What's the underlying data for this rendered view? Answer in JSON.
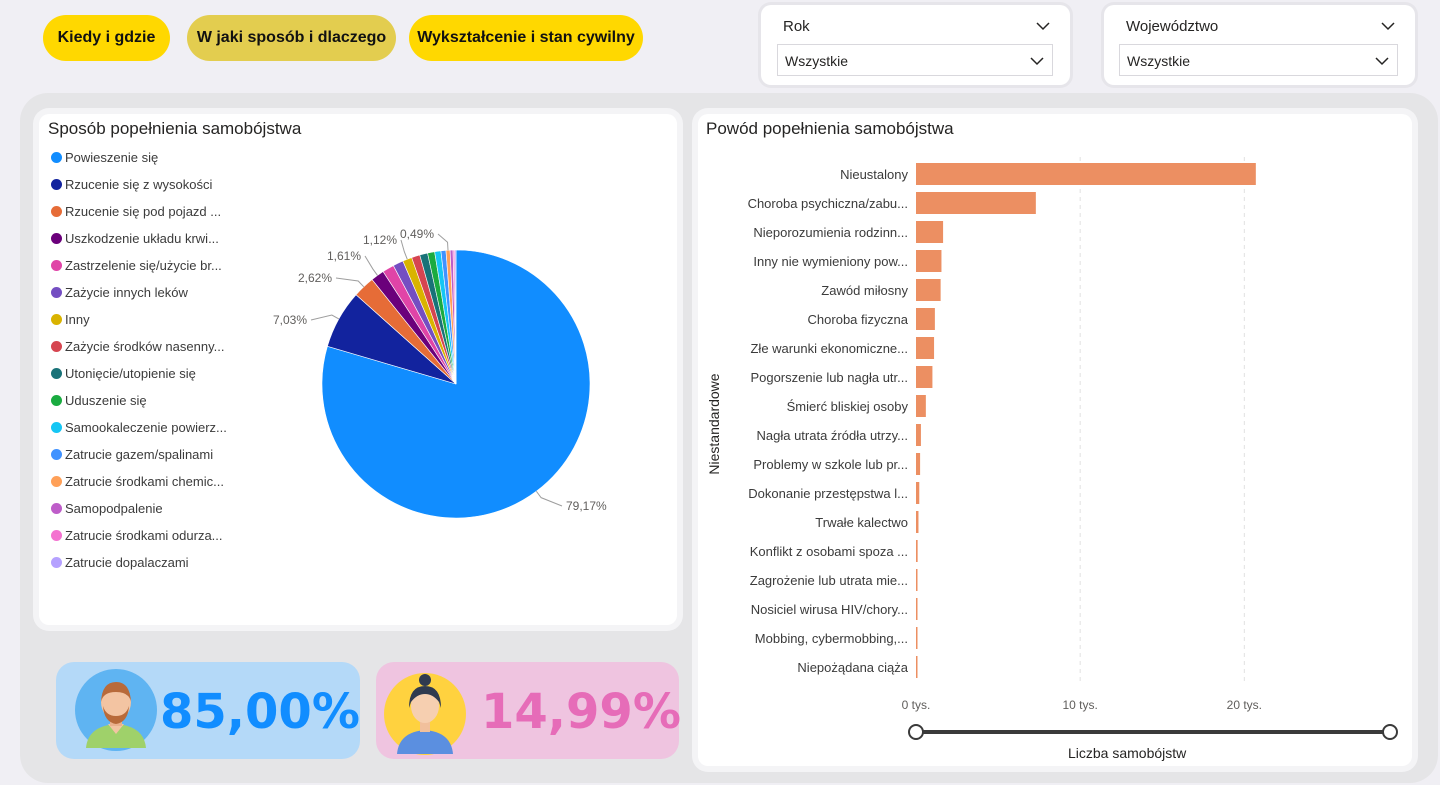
{
  "nav": {
    "btn1": "Kiedy i gdzie",
    "btn2": "W jaki sposób i dlaczego",
    "btn3": "Wykształcenie i stan cywilny"
  },
  "colors": {
    "btn_yellow": "#ffd800",
    "btn_active": "#e3cd4f",
    "bar": "#ec8f62",
    "kpi_male_bg": "#b4d9f8",
    "kpi_male_text": "#118dff",
    "kpi_female_bg": "#efc4e0",
    "kpi_female_text": "#e66cb8"
  },
  "filters": {
    "year": {
      "title": "Rok",
      "value": "Wszystkie"
    },
    "voivodeship": {
      "title": "Województwo",
      "value": "Wszystkie"
    }
  },
  "method_chart": {
    "title": "Sposób popełnienia samobójstwa",
    "legend": [
      {
        "label": "Powieszenie się",
        "color": "#118dff"
      },
      {
        "label": "Rzucenie się z wysokości",
        "color": "#12239e"
      },
      {
        "label": "Rzucenie się pod pojazd ...",
        "color": "#e66c37"
      },
      {
        "label": "Uszkodzenie układu krwi...",
        "color": "#6b007b"
      },
      {
        "label": "Zastrzelenie się/użycie br...",
        "color": "#e044a7"
      },
      {
        "label": "Zażycie innych leków",
        "color": "#744ec2"
      },
      {
        "label": "Inny",
        "color": "#d9b300"
      },
      {
        "label": "Zażycie środków nasenny...",
        "color": "#d64550"
      },
      {
        "label": "Utonięcie/utopienie się",
        "color": "#197278"
      },
      {
        "label": "Uduszenie się",
        "color": "#1aab40"
      },
      {
        "label": "Samookaleczenie powierz...",
        "color": "#15c6f4"
      },
      {
        "label": "Zatrucie gazem/spalinami",
        "color": "#4092ff"
      },
      {
        "label": "Zatrucie środkami chemic...",
        "color": "#ffa058"
      },
      {
        "label": "Samopodpalenie",
        "color": "#be5dc9"
      },
      {
        "label": "Zatrucie środkami odurza...",
        "color": "#f472d0"
      },
      {
        "label": "Zatrucie dopalaczami",
        "color": "#b5a1ff"
      }
    ]
  },
  "chart_data": [
    {
      "type": "pie",
      "title": "Sposób popełnienia samobójstwa",
      "labels": [
        "Powieszenie się",
        "Rzucenie się z wysokości",
        "Rzucenie się pod pojazd ...",
        "Uszkodzenie układu krwi...",
        "Zastrzelenie się/użycie br...",
        "Zażycie innych leków",
        "Inny",
        "Zażycie środków nasenny...",
        "Utonięcie/utopienie się",
        "Uduszenie się",
        "Samookaleczenie powierz...",
        "Zatrucie gazem/spalinami",
        "Zatrucie środkami chemic...",
        "Samopodpalenie",
        "Zatrucie środkami odurza...",
        "Zatrucie dopalaczami"
      ],
      "values": [
        79.17,
        7.03,
        2.62,
        1.61,
        1.4,
        1.25,
        1.12,
        1.0,
        0.95,
        0.85,
        0.75,
        0.6,
        0.49,
        0.35,
        0.2,
        0.15
      ],
      "data_labels": [
        "79,17%",
        "7,03%",
        "2,62%",
        "1,61%",
        "1,12%",
        "0,49%"
      ]
    },
    {
      "type": "bar",
      "orientation": "horizontal",
      "title": "Powód popełnienia samobójstwa",
      "categories": [
        "Nieustalony",
        "Choroba psychiczna/zabu...",
        "Nieporozumienia rodzinn...",
        "Inny nie wymieniony pow...",
        "Zawód miłosny",
        "Choroba fizyczna",
        "Złe warunki ekonomiczne...",
        "Pogorszenie lub nagła utr...",
        "Śmierć bliskiej osoby",
        "Nagła utrata źródła utrzy...",
        "Problemy w szkole lub pr...",
        "Dokonanie przestępstwa l...",
        "Trwałe kalectwo",
        "Konflikt z osobami spoza ...",
        "Zagrożenie lub utrata mie...",
        "Nosiciel wirusa HIV/chory...",
        "Mobbing, cybermobbing,...",
        "Niepożądana ciąża"
      ],
      "values": [
        20700,
        7300,
        1650,
        1550,
        1500,
        1150,
        1100,
        1000,
        600,
        300,
        250,
        200,
        150,
        100,
        80,
        60,
        50,
        40
      ],
      "xlabel": "Liczba samobójstw",
      "ylabel": "Niestandardowe",
      "xlim": [
        0,
        24000
      ],
      "xticks": [
        "0 tys.",
        "10 tys.",
        "20 tys."
      ],
      "xtick_values": [
        0,
        10000,
        20000
      ],
      "grid": true
    }
  ],
  "reason_chart": {
    "title": "Powód popełnienia samobójstwa",
    "ylabel": "Niestandardowe",
    "xlabel": "Liczba samobójstw",
    "ticks": [
      "0 tys.",
      "10 tys.",
      "20 tys."
    ]
  },
  "kpi": {
    "male": "85,00%",
    "female": "14,99%"
  }
}
